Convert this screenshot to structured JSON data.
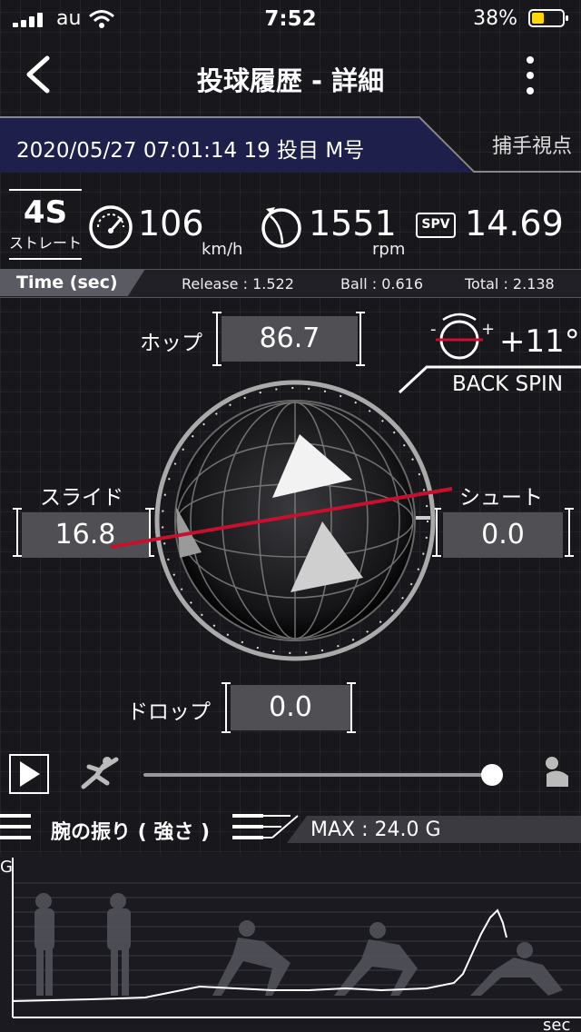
{
  "status": {
    "carrier": "au",
    "time": "7:52",
    "battery": "38%"
  },
  "nav": {
    "title": "投球履歴 - 詳細"
  },
  "header": {
    "info": "2020/05/27 07:01:14 19 投目 M号",
    "view_tab": "捕手視点"
  },
  "pitch": {
    "code": "4S",
    "type": "ストレート",
    "speed": "106",
    "speed_unit": "km/h",
    "rpm": "1551",
    "rpm_unit": "rpm",
    "spv_label": "SPV",
    "spv": "14.69"
  },
  "time": {
    "label": "Time (sec)",
    "release": "Release : 1.522",
    "ball": "Ball : 0.616",
    "total": "Total : 2.138"
  },
  "movement": {
    "hop_label": "ホップ",
    "hop": "86.7",
    "slide_label": "スライド",
    "slide": "16.8",
    "shoot_label": "シュート",
    "shoot": "0.0",
    "drop_label": "ドロップ",
    "drop": "0.0",
    "tilt": "+11°",
    "spin_type": "BACK SPIN"
  },
  "playback": {
    "progress": 1.0
  },
  "arm": {
    "label": "腕の振り ( 強さ )",
    "max": "MAX : 24.0 G",
    "y_axis": "G",
    "x_axis": "sec"
  },
  "colors": {
    "accent": "#c8102e",
    "band": "#1e1f4a"
  }
}
